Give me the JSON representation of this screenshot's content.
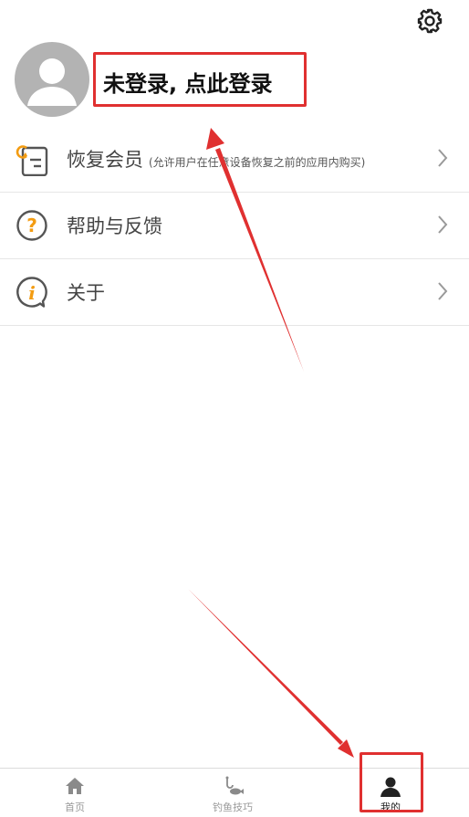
{
  "header": {
    "settings_icon": "gear-icon"
  },
  "profile": {
    "avatar_icon": "user-avatar-icon",
    "login_text": "未登录, 点此登录"
  },
  "menu": {
    "items": [
      {
        "icon": "restore-membership-icon",
        "label": "恢复会员",
        "sub": "(允许用户在任意设备恢复之前的应用内购买)"
      },
      {
        "icon": "help-icon",
        "label": "帮助与反馈"
      },
      {
        "icon": "info-icon",
        "label": "关于"
      }
    ]
  },
  "tabbar": {
    "tabs": [
      {
        "icon": "home-icon",
        "label": "首页",
        "active": false
      },
      {
        "icon": "fishing-icon",
        "label": "钓鱼技巧",
        "active": false
      },
      {
        "icon": "user-icon",
        "label": "我的",
        "active": true
      }
    ]
  },
  "colors": {
    "highlight": "#e03030",
    "accent": "#f39c12",
    "avatar_bg": "#b3b3b3"
  }
}
